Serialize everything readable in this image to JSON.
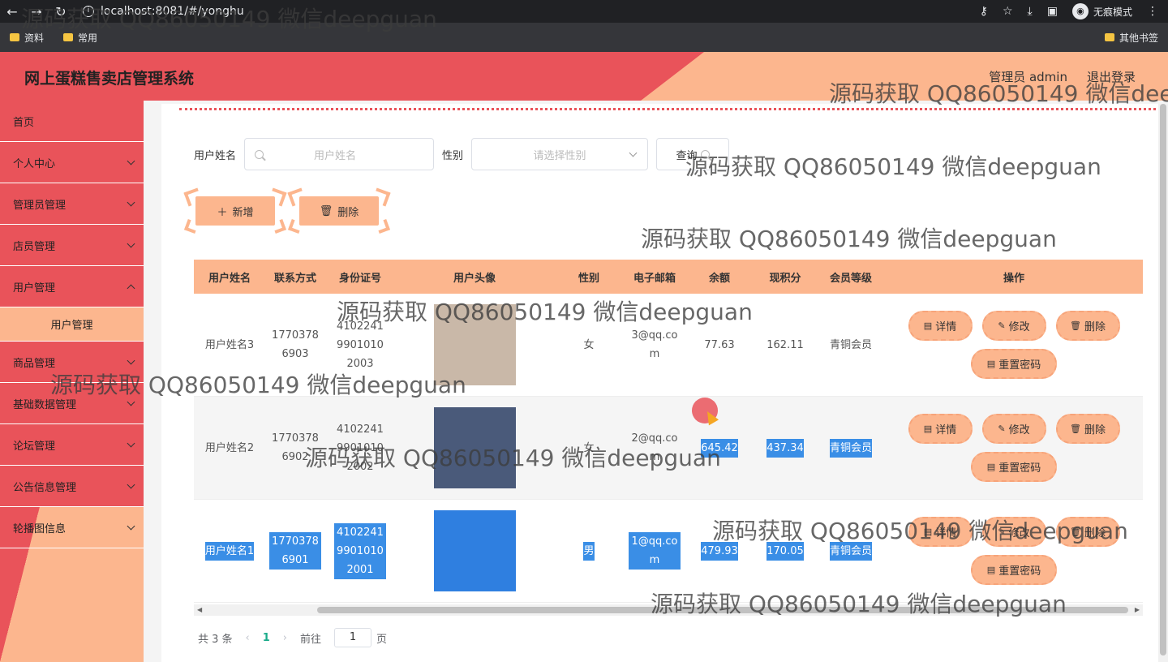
{
  "browser": {
    "url": "localhost:8081/#/yonghu",
    "incognito_label": "无痕模式",
    "bookmarks": [
      "资料",
      "常用"
    ],
    "other_bookmarks": "其他书签"
  },
  "header": {
    "title": "网上蛋糕售卖店管理系统",
    "admin": "管理员 admin",
    "logout": "退出登录"
  },
  "sidebar": {
    "items": [
      {
        "label": "首页"
      },
      {
        "label": "个人中心"
      },
      {
        "label": "管理员管理"
      },
      {
        "label": "店员管理"
      },
      {
        "label": "用户管理"
      },
      {
        "label": "商品管理"
      },
      {
        "label": "基础数据管理"
      },
      {
        "label": "论坛管理"
      },
      {
        "label": "公告信息管理"
      },
      {
        "label": "轮播图信息"
      }
    ],
    "sub_item": "用户管理"
  },
  "search": {
    "name_label": "用户姓名",
    "name_placeholder": "用户姓名",
    "gender_label": "性别",
    "gender_placeholder": "请选择性别",
    "query_button": "查询"
  },
  "actions": {
    "add": "新增",
    "delete": "删除"
  },
  "table": {
    "columns": [
      "用户姓名",
      "联系方式",
      "身份证号",
      "用户头像",
      "性别",
      "电子邮箱",
      "余额",
      "现积分",
      "会员等级",
      "操作"
    ],
    "rows": [
      {
        "name": "用户姓名3",
        "phone": "17703786903",
        "id": "410224199010102003",
        "gender": "女",
        "email": "3@qq.com",
        "balance": "77.63",
        "points": "162.11",
        "level": "青铜会员",
        "avatar_color": "#c9b8a8"
      },
      {
        "name": "用户姓名2",
        "phone": "17703786902",
        "id": "410224199010102002",
        "gender": "女",
        "email": "2@qq.com",
        "balance": "645.42",
        "points": "437.34",
        "level": "青铜会员",
        "avatar_color": "#4a5a7a"
      },
      {
        "name": "用户姓名1",
        "phone": "17703786901",
        "id": "410224199010102001",
        "gender": "男",
        "email": "1@qq.com",
        "balance": "479.93",
        "points": "170.05",
        "level": "青铜会员",
        "avatar_color": "#2f7fe0"
      }
    ],
    "ops": {
      "detail": "详情",
      "edit": "修改",
      "delete": "删除",
      "reset": "重置密码"
    }
  },
  "pager": {
    "total": "共 3 条",
    "current": "1",
    "goto_label": "前往",
    "goto_value": "1",
    "page_unit": "页"
  },
  "watermark": "源码获取 QQ86050149 微信deepguan",
  "colors": {
    "primary_red": "#e9535a",
    "peach": "#fcb68e",
    "selection": "#3a8ee6"
  }
}
